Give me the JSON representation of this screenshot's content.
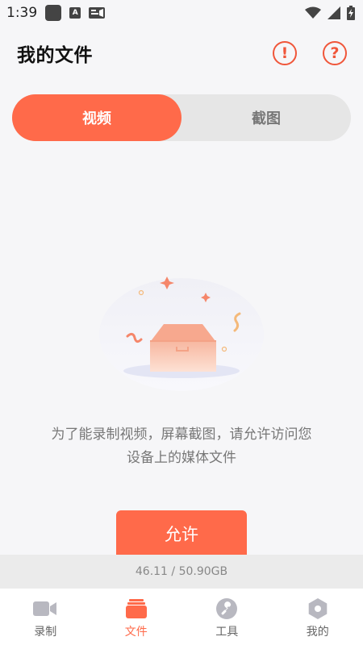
{
  "status_bar": {
    "time": "1:39",
    "a_glyph": "A"
  },
  "header": {
    "title": "我的文件",
    "info_glyph": "!",
    "help_glyph": "?"
  },
  "tabs": [
    {
      "label": "视频",
      "active": true
    },
    {
      "label": "截图",
      "active": false
    }
  ],
  "empty_state": {
    "message": "为了能录制视频，屏幕截图，请允许访问您设备上的媒体文件"
  },
  "allow_button": {
    "label": "允许"
  },
  "storage": {
    "text": "46.11 / 50.90GB"
  },
  "nav": [
    {
      "label": "录制",
      "icon": "video-camera-icon",
      "active": false
    },
    {
      "label": "文件",
      "icon": "folder-stack-icon",
      "active": true
    },
    {
      "label": "工具",
      "icon": "wrench-icon",
      "active": false
    },
    {
      "label": "我的",
      "icon": "hexagon-user-icon",
      "active": false
    }
  ],
  "colors": {
    "accent": "#ff6a4a",
    "icon_gray": "#b8b8c0"
  }
}
